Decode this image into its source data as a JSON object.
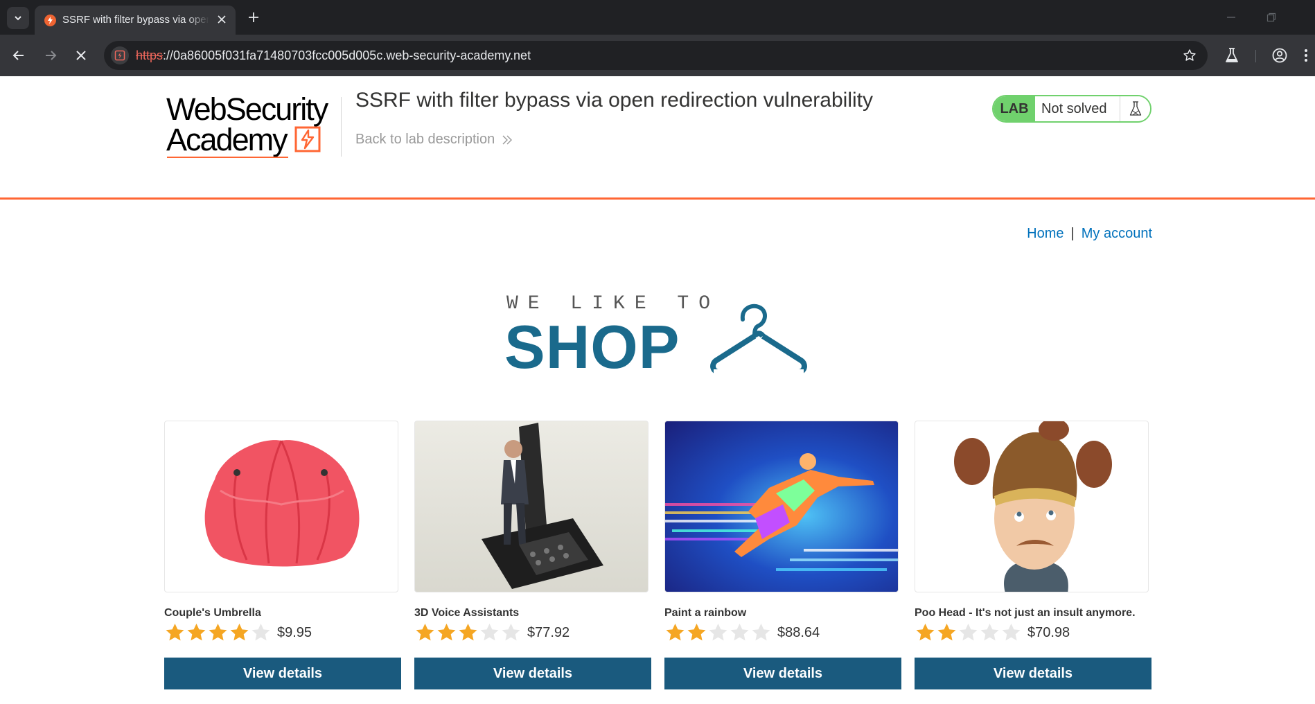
{
  "browser": {
    "tab_title": "SSRF with filter bypass via open redirection vulnerability",
    "url_scheme": "https",
    "url_rest": "://0a86005f031fa71480703fcc005d005c.web-security-academy.net",
    "icons": [
      "tab-list-icon",
      "favicon-icon",
      "close-icon",
      "plus-icon",
      "minimize-icon",
      "restore-icon",
      "back-arrow-icon",
      "forward-arrow-icon",
      "stop-loading-icon",
      "site-info-icon",
      "star-icon",
      "labs-flask-icon",
      "profile-icon",
      "kebab-menu-icon"
    ]
  },
  "header": {
    "logo_line1": "WebSecurity",
    "logo_line2": "Academy",
    "lab_title": "SSRF with filter bypass via open redirection vulnerability",
    "back_link": "Back to lab description",
    "lab_badge": "LAB",
    "lab_status": "Not solved"
  },
  "nav": {
    "home": "Home",
    "separator": "|",
    "account": "My account"
  },
  "shop_logo": {
    "small": "WE LIKE TO",
    "big": "SHOP"
  },
  "colors": {
    "accent_orange": "#ff6633",
    "lab_green": "#70d16d",
    "link_blue": "#0071bc",
    "shop_blue": "#1a6a8c",
    "button_blue": "#1a5a7e",
    "star_gold": "#f5a623"
  },
  "products": [
    {
      "name": "Couple's Umbrella",
      "rating": 4,
      "max_rating": 5,
      "price": "$9.95",
      "button": "View details"
    },
    {
      "name": "3D Voice Assistants",
      "rating": 3,
      "max_rating": 5,
      "price": "$77.92",
      "button": "View details"
    },
    {
      "name": "Paint a rainbow",
      "rating": 2,
      "max_rating": 5,
      "price": "$88.64",
      "button": "View details"
    },
    {
      "name": "Poo Head - It's not just an insult anymore.",
      "rating": 2,
      "max_rating": 5,
      "price": "$70.98",
      "button": "View details"
    }
  ]
}
